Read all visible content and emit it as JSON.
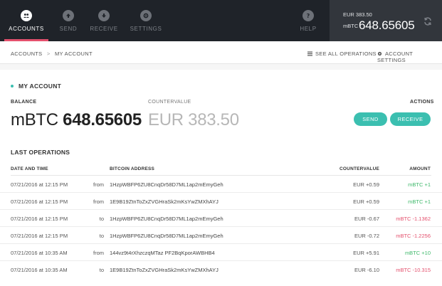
{
  "nav": {
    "tabs": [
      {
        "label": "ACCOUNTS",
        "icon": "accounts-icon",
        "active": true
      },
      {
        "label": "SEND",
        "icon": "send-icon",
        "active": false
      },
      {
        "label": "RECEIVE",
        "icon": "receive-icon",
        "active": false
      },
      {
        "label": "SETTINGS",
        "icon": "settings-icon",
        "active": false
      }
    ],
    "help": {
      "label": "HELP",
      "icon": "help-icon"
    }
  },
  "header_balance": {
    "eur": "EUR 383.50",
    "unit": "mBTC",
    "value": "648.65605",
    "sync_icon": "sync-icon"
  },
  "breadcrumb": {
    "root": "ACCOUNTS",
    "separator": ">",
    "current": "MY ACCOUNT"
  },
  "actions_bar": {
    "see_all": "SEE ALL OPERATIONS",
    "account_settings": "ACCOUNT SETTINGS"
  },
  "account": {
    "title": "MY ACCOUNT",
    "balance_label": "BALANCE",
    "balance_unit": "mBTC",
    "balance_value": "648.65605",
    "countervalue_label": "COUNTERVALUE",
    "countervalue": "EUR 383.50",
    "actions_label": "ACTIONS",
    "send_label": "SEND",
    "receive_label": "RECEIVE"
  },
  "operations": {
    "title": "LAST OPERATIONS",
    "headers": {
      "date": "DATE AND TIME",
      "address": "BITCOIN ADDRESS",
      "countervalue": "COUNTERVALUE",
      "amount": "AMOUNT"
    },
    "rows": [
      {
        "date": "07/21/2016 at 12:15 PM",
        "dir": "from",
        "address": "1HzpWBFP6ZU8CnqDr58D7ML1ap2mEmyGeh",
        "countervalue": "EUR +0.59",
        "amount": "mBTC +1",
        "sign": "pos"
      },
      {
        "date": "07/21/2016 at 12:15 PM",
        "dir": "from",
        "address": "1E9B19ZtnToZxZVGHraSk2mKsYwZMXhAYJ",
        "countervalue": "EUR +0.59",
        "amount": "mBTC +1",
        "sign": "pos"
      },
      {
        "date": "07/21/2016 at 12:15 PM",
        "dir": "to",
        "address": "1HzpWBFP6ZU8CnqDr58D7ML1ap2mEmyGeh",
        "countervalue": "EUR -0.67",
        "amount": "mBTC -1.1362",
        "sign": "neg"
      },
      {
        "date": "07/21/2016 at 12:15 PM",
        "dir": "to",
        "address": "1HzpWBFP6ZU8CnqDr58D7ML1ap2mEmyGeh",
        "countervalue": "EUR -0.72",
        "amount": "mBTC -1.2256",
        "sign": "neg"
      },
      {
        "date": "07/21/2016 at 10:35 AM",
        "dir": "from",
        "address": "144vz9t4rXhzczqMTaz PF2BqKporAWBHB4",
        "countervalue": "EUR +5.91",
        "amount": "mBTC +10",
        "sign": "pos"
      },
      {
        "date": "07/21/2016 at 10:35 AM",
        "dir": "to",
        "address": "1E9B19ZtnToZxZVGHraSk2mKsYwZMXhAYJ",
        "countervalue": "EUR -6.10",
        "amount": "mBTC -10.315",
        "sign": "neg"
      }
    ]
  },
  "colors": {
    "accent": "#3bbfb0",
    "active_tab_underline": "#e3506d",
    "positive": "#3fb96b",
    "negative": "#e4506d",
    "topbar": "#1f2329"
  }
}
